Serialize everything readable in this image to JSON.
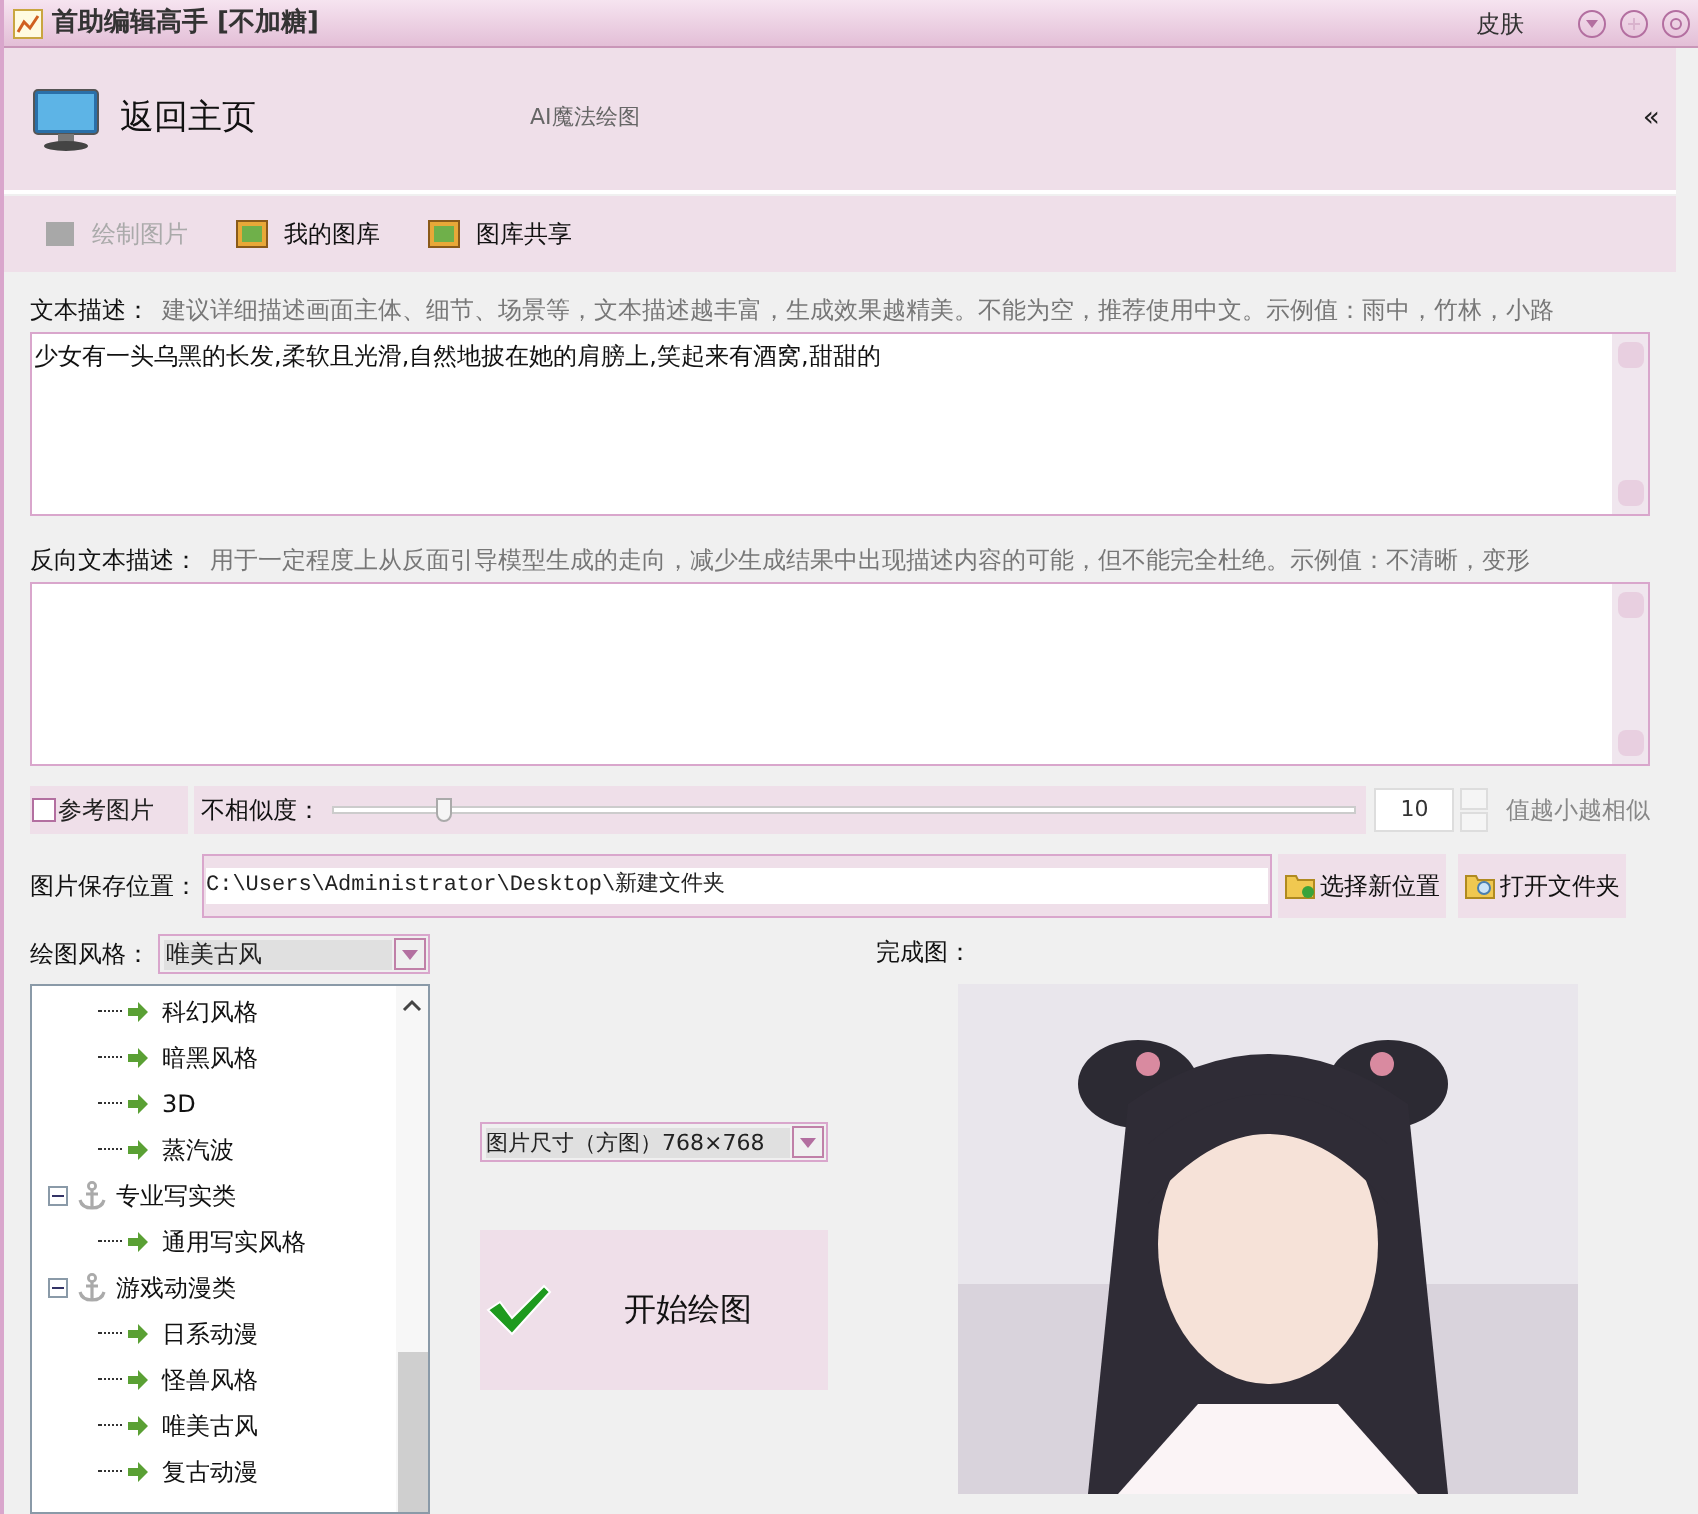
{
  "window": {
    "title": "首助编辑高手 [不加糖]",
    "skin": "皮肤"
  },
  "header": {
    "home": "返回主页",
    "subtitle": "AI魔法绘图",
    "collapse": "«"
  },
  "toolbar": [
    {
      "label": "绘制图片",
      "disabled": true
    },
    {
      "label": "我的图库",
      "disabled": false
    },
    {
      "label": "图库共享",
      "disabled": false
    }
  ],
  "prompt": {
    "label": "文本描述：",
    "hint": "建议详细描述画面主体、细节、场景等，文本描述越丰富，生成效果越精美。不能为空，推荐使用中文。示例值：雨中，竹林，小路",
    "value": "少女有一头乌黑的长发,柔软且光滑,自然地披在她的肩膀上,笑起来有酒窝,甜甜的"
  },
  "negative_prompt": {
    "label": "反向文本描述：",
    "hint": "用于一定程度上从反面引导模型生成的走向，减少生成结果中出现描述内容的可能，但不能完全杜绝。示例值：不清晰，变形"
  },
  "reference": {
    "label": "参考图片",
    "checked": false
  },
  "similarity": {
    "label": "不相似度：",
    "level": 0.1,
    "value": "10",
    "hint": "值越小越相似"
  },
  "save": {
    "label": "图片保存位置：",
    "path": "C:\\Users\\Administrator\\Desktop\\新建文件夹",
    "buttons": [
      "选择新位置",
      "打开文件夹"
    ]
  },
  "style": {
    "label": "绘图风格：",
    "value": "唯美古风",
    "tree": [
      {
        "kind": "group",
        "children": [
          {
            "label": "科幻风格"
          },
          {
            "label": "暗黑风格"
          },
          {
            "label": "3D"
          },
          {
            "label": "蒸汽波"
          }
        ]
      },
      {
        "kind": "category",
        "label": "专业写实类",
        "expanded": true,
        "children": [
          {
            "label": "通用写实风格"
          }
        ]
      },
      {
        "kind": "category",
        "label": "游戏动漫类",
        "expanded": true,
        "children": [
          {
            "label": "日系动漫"
          },
          {
            "label": "怪兽风格"
          },
          {
            "label": "唯美古风"
          },
          {
            "label": "复古动漫"
          }
        ]
      }
    ]
  },
  "size_select": {
    "value": "图片尺寸（方图）768×768"
  },
  "start_button": {
    "label": "开始绘图"
  },
  "result": {
    "label": "完成图：",
    "kind": "picture"
  }
}
